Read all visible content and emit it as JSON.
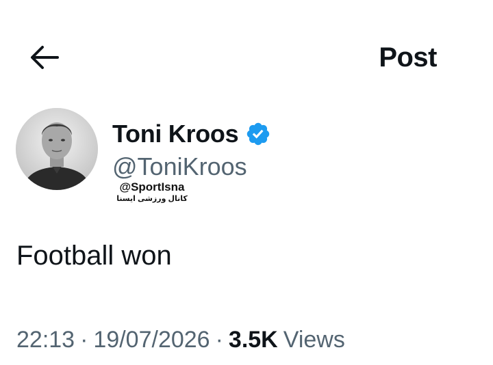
{
  "header": {
    "back_icon": "arrow-left-icon",
    "title": "Post"
  },
  "author": {
    "display_name": "Toni Kroos",
    "handle": "@ToniKroos",
    "verified_icon": "verified-badge-icon",
    "verified_color": "#1d9bf0"
  },
  "watermark": {
    "handle": "@SportIsna",
    "subtitle": "کانال ورزشی ایسنا"
  },
  "tweet": {
    "text": "Football won"
  },
  "meta": {
    "time": "22:13",
    "separator": "·",
    "date": "19/07/2026",
    "views_count": "3.5K",
    "views_label": "Views"
  },
  "colors": {
    "text_primary": "#0f1419",
    "text_secondary": "#536471",
    "background": "#ffffff"
  }
}
